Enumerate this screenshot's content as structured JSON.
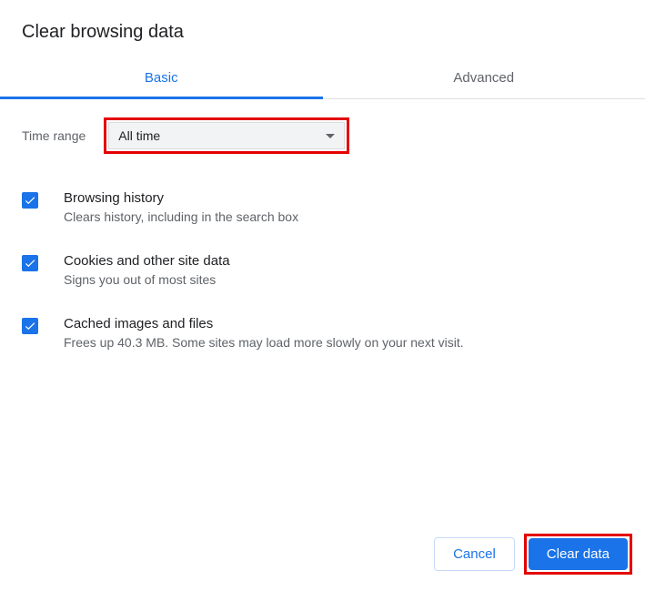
{
  "title": "Clear browsing data",
  "tabs": {
    "basic": "Basic",
    "advanced": "Advanced"
  },
  "time_range": {
    "label": "Time range",
    "selected": "All time"
  },
  "options": {
    "browsing_history": {
      "title": "Browsing history",
      "desc": "Clears history, including in the search box"
    },
    "cookies": {
      "title": "Cookies and other site data",
      "desc": "Signs you out of most sites"
    },
    "cache": {
      "title": "Cached images and files",
      "desc": "Frees up 40.3 MB. Some sites may load more slowly on your next visit."
    }
  },
  "buttons": {
    "cancel": "Cancel",
    "clear": "Clear data"
  }
}
